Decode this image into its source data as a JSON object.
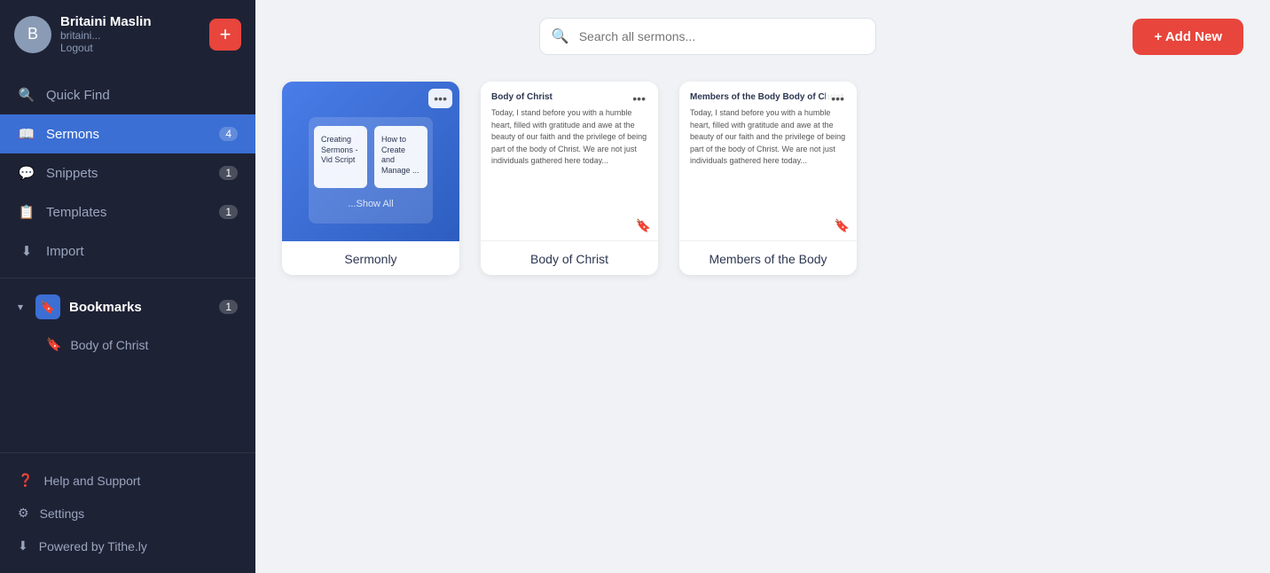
{
  "sidebar": {
    "user": {
      "name": "Britaini Maslin",
      "email": "britaini...",
      "logout": "Logout"
    },
    "nav_items": [
      {
        "id": "quick-find",
        "label": "Quick Find",
        "icon": "🔍",
        "badge": null,
        "active": false
      },
      {
        "id": "sermons",
        "label": "Sermons",
        "icon": "📖",
        "badge": "4",
        "active": true
      },
      {
        "id": "snippets",
        "label": "Snippets",
        "icon": "💬",
        "badge": "1",
        "active": false
      },
      {
        "id": "templates",
        "label": "Templates",
        "icon": "📋",
        "badge": "1",
        "active": false
      },
      {
        "id": "import",
        "label": "Import",
        "icon": "⬇",
        "badge": null,
        "active": false
      }
    ],
    "bookmarks": {
      "label": "Bookmarks",
      "badge": "1",
      "items": [
        {
          "id": "body-of-christ",
          "label": "Body of Christ"
        }
      ]
    },
    "footer": [
      {
        "id": "help",
        "label": "Help and Support",
        "icon": "❓"
      },
      {
        "id": "settings",
        "label": "Settings",
        "icon": "⚙"
      },
      {
        "id": "powered",
        "label": "Powered by Tithe.ly",
        "icon": "⬇"
      }
    ]
  },
  "header": {
    "search_placeholder": "Search all sermons...",
    "add_new_label": "+ Add New"
  },
  "cards": [
    {
      "id": "sermonly",
      "label": "Sermonly",
      "type": "folder",
      "tabs": [
        {
          "title": "Creating Sermons - Vid Script"
        },
        {
          "title": "How to Create and Manage ..."
        }
      ],
      "show_all": "...Show All"
    },
    {
      "id": "body-of-christ",
      "label": "Body of Christ",
      "type": "text",
      "title": "Body of Christ",
      "body": "Today, I stand before you with a humble heart, filled with gratitude and awe at the beauty of our faith and the privilege of being part of the body of Christ. We are not just individuals gathered here today..."
    },
    {
      "id": "members-of-body",
      "label": "Members of the Body",
      "type": "text",
      "title": "Members of the Body Body of Christ",
      "body": "Today, I stand before you with a humble heart, filled with gratitude and awe at the beauty of our faith and the privilege of being part of the body of Christ. We are not just individuals gathered here today..."
    }
  ]
}
